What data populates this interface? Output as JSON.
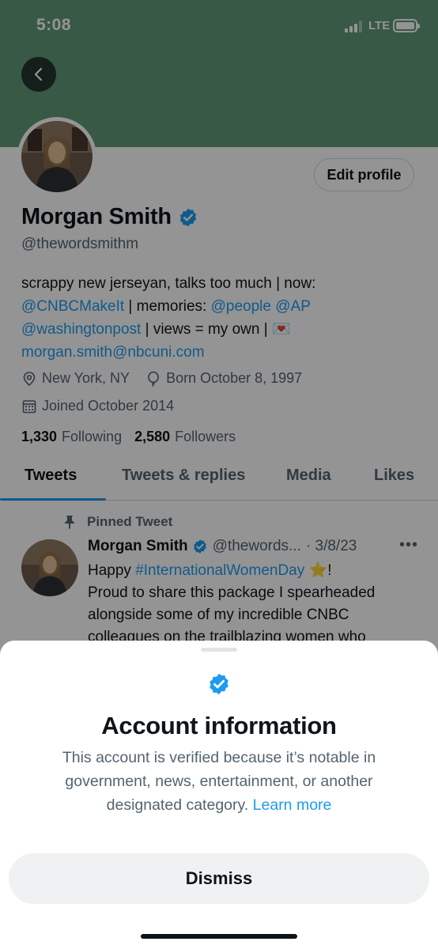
{
  "status_bar": {
    "time": "5:08",
    "network": "LTE"
  },
  "profile": {
    "edit_button": "Edit profile",
    "name": "Morgan Smith",
    "handle": "@thewordsmithm",
    "bio": {
      "line1": "scrappy new jerseyan, talks too much | now:",
      "mention_cnbc": "@CNBCMakeIt",
      "memories_text": " | memories: ",
      "mention_people": "@people",
      "mention_ap": "@AP",
      "mention_wapo": "@washingtonpost",
      "views_text": " | views = my own | ",
      "email_emoji": "💌",
      "email": "morgan.smith@nbcuni.com"
    },
    "location": "New York, NY",
    "birthday": "Born October 8, 1997",
    "joined": "Joined October 2014",
    "following_count": "1,330",
    "following_label": "Following",
    "followers_count": "2,580",
    "followers_label": "Followers"
  },
  "tabs": [
    {
      "label": "Tweets",
      "active": true
    },
    {
      "label": "Tweets & replies",
      "active": false
    },
    {
      "label": "Media",
      "active": false
    },
    {
      "label": "Likes",
      "active": false
    }
  ],
  "pinned_tweet": {
    "pinned_label": "Pinned Tweet",
    "author_name": "Morgan Smith",
    "author_handle": "@thewords...",
    "date": "· 3/8/23",
    "text_prefix": "Happy ",
    "hashtag": "#InternationalWomenDay",
    "star_emoji": "⭐",
    "text_suffix": "!",
    "body_lines": [
      "Proud to share this package I spearheaded",
      "alongside some of my incredible CNBC",
      "colleagues on the trailblazing women who"
    ]
  },
  "sheet": {
    "title": "Account information",
    "description": "This account is verified because it’s notable in government, news, entertainment, or another designated category.",
    "learn_more": "Learn more",
    "dismiss_label": "Dismiss"
  },
  "colors": {
    "banner": "#5f9a78",
    "link": "#1d9bf0",
    "secondary_text": "#536471"
  },
  "icons": [
    "chevron-left-icon",
    "verified-badge-icon",
    "location-pin-icon",
    "balloon-icon",
    "calendar-icon",
    "pin-icon",
    "more-icon"
  ]
}
